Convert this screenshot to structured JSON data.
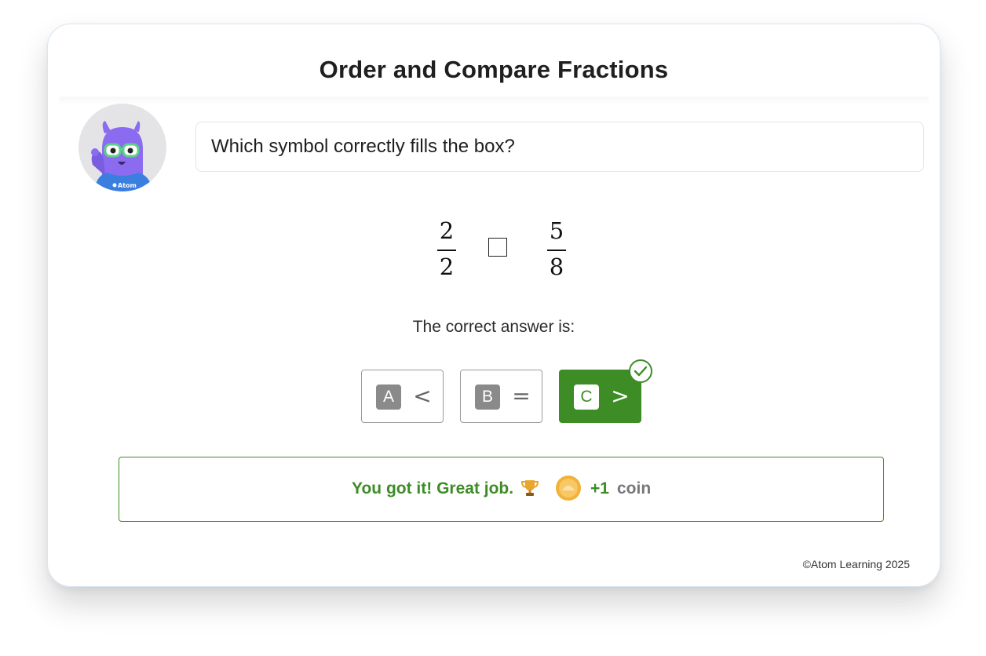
{
  "page": {
    "title": "Order and Compare Fractions",
    "copyright": "©Atom Learning 2025"
  },
  "question": {
    "text": "Which symbol correctly fills the box?",
    "left_fraction": {
      "numerator": "2",
      "denominator": "2"
    },
    "right_fraction": {
      "numerator": "5",
      "denominator": "8"
    }
  },
  "answer": {
    "label": "The correct answer is:",
    "options": [
      {
        "letter": "A",
        "symbol": "<",
        "correct": false
      },
      {
        "letter": "B",
        "symbol": "=",
        "correct": false
      },
      {
        "letter": "C",
        "symbol": ">",
        "correct": true
      }
    ]
  },
  "feedback": {
    "message": "You got it! Great job.",
    "reward_amount": "+1",
    "reward_unit": "coin"
  },
  "colors": {
    "success": "#3d8c26",
    "mascot": "#8b6cf0",
    "coin": "#f2b23a"
  },
  "icons": {
    "mascot": "purple-monster-avatar",
    "box": "empty-box",
    "check": "check-circle-icon",
    "trophy": "trophy-icon",
    "coin": "coin-icon"
  }
}
